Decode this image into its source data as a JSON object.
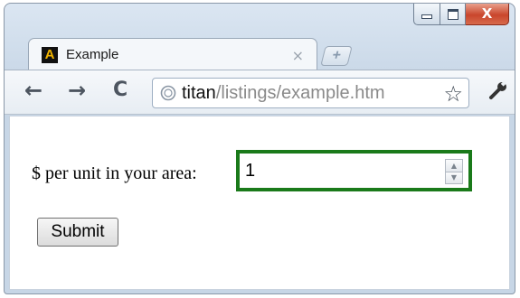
{
  "window": {
    "controls": {
      "minimize": "–",
      "maximize": "□",
      "close": "X"
    }
  },
  "tab": {
    "favicon_letter": "A",
    "title": "Example",
    "close_glyph": "×",
    "new_tab_glyph": "+"
  },
  "toolbar": {
    "back_glyph": "←",
    "forward_glyph": "→",
    "reload_glyph": "C",
    "url_host": "titan",
    "url_path": "/listings/example.htm",
    "star_glyph": "☆",
    "wrench_glyph": "🔧"
  },
  "form": {
    "label": "$ per unit in your area:",
    "number_value": "1",
    "submit_label": "Submit"
  },
  "colors": {
    "focus_border": "#1a7a1a"
  },
  "icons": [
    "browser-favicon-icon",
    "tab-close-icon",
    "new-tab-icon",
    "back-arrow-icon",
    "forward-arrow-icon",
    "reload-icon",
    "globe-icon",
    "bookmark-star-icon",
    "wrench-icon",
    "spinner-up-icon",
    "spinner-down-icon"
  ]
}
